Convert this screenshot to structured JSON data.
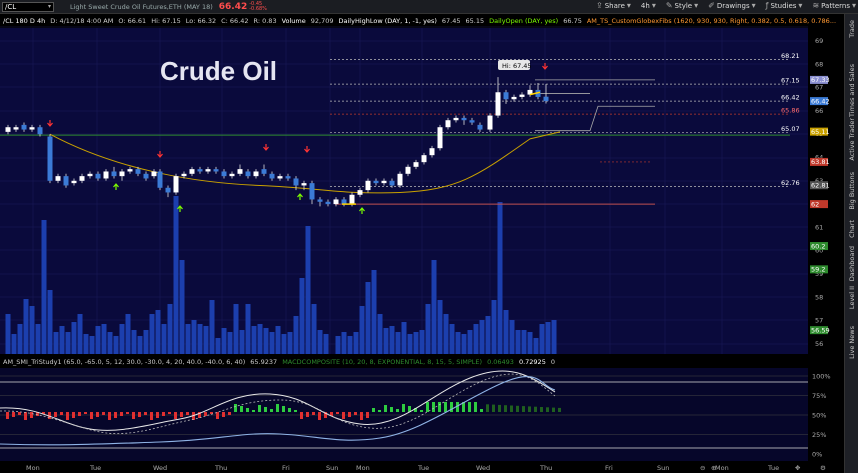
{
  "toolbar": {
    "symbol": "/CL",
    "description": "Light Sweet Crude Oil Futures,ETH (MAY 18)",
    "last_price": "66.42",
    "change": "-0.45",
    "change_pct": "-0.68%",
    "share": "Share",
    "period": "4h",
    "style": "Style",
    "drawings": "Drawings",
    "studies": "Studies",
    "patterns": "Patterns"
  },
  "right_tabs": [
    "Trade",
    "Times and Sales",
    "Active Trader",
    "Big Buttons",
    "Chart",
    "Dashboard",
    "Level II",
    "Live News"
  ],
  "chart_header": {
    "segments": [
      {
        "text": "/CL 180 D 4h",
        "color": "#ffffff"
      },
      {
        "text": "D: 4/12/18 4:00 AM",
        "color": "#cccccc"
      },
      {
        "text": "O: 66.61",
        "color": "#cccccc"
      },
      {
        "text": "Hi: 67.15",
        "color": "#cccccc"
      },
      {
        "text": "Lo: 66.32",
        "color": "#cccccc"
      },
      {
        "text": "C: 66.42",
        "color": "#cccccc"
      },
      {
        "text": "R: 0.83",
        "color": "#cccccc"
      },
      {
        "text": "Volume",
        "color": "#ffffff"
      },
      {
        "text": "92,709",
        "color": "#cccccc"
      },
      {
        "text": "DailyHighLow (DAY, 1, -1, yes)",
        "color": "#ffffff"
      },
      {
        "text": "67.45",
        "color": "#cccccc"
      },
      {
        "text": "65.15",
        "color": "#cccccc"
      },
      {
        "text": "DailyOpen (DAY, yes)",
        "color": "#7CFC00"
      },
      {
        "text": "66.75",
        "color": "#cccccc"
      },
      {
        "text": "AM_TS_CustomGlobexFibs (1620, 930, 930, Right, 0.382, 0.5, 0.618, 0.786...",
        "color": "#ff9933"
      }
    ]
  },
  "annotation_title": "Crude Oil",
  "hi_callout": "Hi: 67.45",
  "price_axis": {
    "ticks": [
      "69",
      "68",
      "67",
      "66",
      "65",
      "64",
      "63",
      "62",
      "61",
      "60",
      "59",
      "58",
      "57",
      "56"
    ],
    "badges": [
      {
        "text": "67.33",
        "color": "#8a8fd0"
      },
      {
        "text": "66.42",
        "color": "#3b7bd6"
      },
      {
        "text": "65.11",
        "color": "#c9a100"
      },
      {
        "text": "63.81",
        "color": "#c0392b"
      },
      {
        "text": "62.81",
        "color": "#555555"
      },
      {
        "text": "62",
        "color": "#c0392b"
      },
      {
        "text": "60.2",
        "color": "#2e8b2e"
      },
      {
        "text": "59.2",
        "color": "#2e8b2e"
      },
      {
        "text": "56.59",
        "color": "#2e8b2e"
      }
    ],
    "level_labels": [
      "68.21",
      "67.15",
      "66.42",
      "65.86",
      "65.07",
      "62.76"
    ]
  },
  "lower_header": {
    "segments": [
      {
        "text": "AM_SMI_TriStudy1 (65.0, -65.0, 5, 12, 30.0, -30.0, 4, 20, 40.0, -40.0, 6, 40)",
        "color": "#cccccc"
      },
      {
        "text": "65.9237",
        "color": "#cccccc"
      },
      {
        "text": "MACDCOMPOSITE (10, 20, 8, EXPONENTIAL, 8, 15, 5, SIMPLE)",
        "color": "#2e8b2e"
      },
      {
        "text": "0.06493",
        "color": "#2e8b2e"
      },
      {
        "text": "0.72925",
        "color": "#ffffff"
      },
      {
        "text": "0",
        "color": "#cccccc"
      }
    ]
  },
  "lower_axis": [
    "100%",
    "75%",
    "50%",
    "25%",
    "0%"
  ],
  "time_axis": [
    "Mon",
    "Tue",
    "Wed",
    "Thu",
    "Fri",
    "Sun",
    "Mon",
    "Tue",
    "Wed",
    "Thu",
    "Fri",
    "Sun",
    "Mon",
    "Tue"
  ],
  "bottom_icons": [
    "zoom-out-icon",
    "zoom-in-icon",
    "crosshair-icon",
    "settings-icon"
  ],
  "colors": {
    "background": "#000000",
    "plot_bg": "#0a0a3c",
    "up_candle": "#ffffff",
    "down_candle": "#3b7bd6",
    "volume": "#1c3fae",
    "sma": "#c9a100"
  }
}
